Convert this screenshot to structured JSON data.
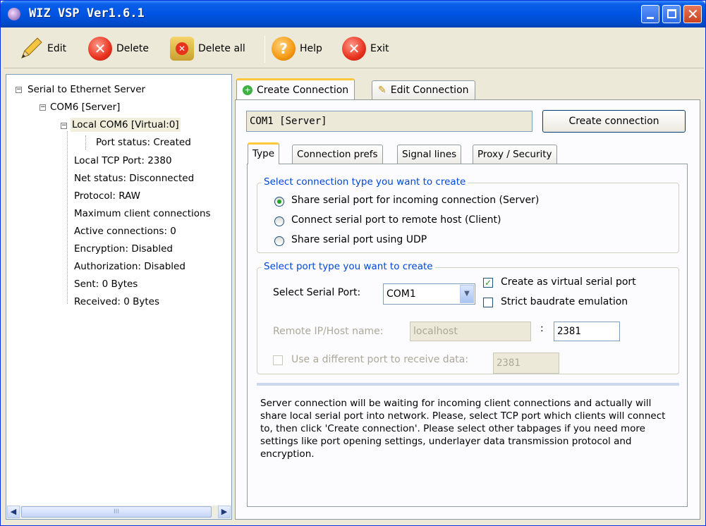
{
  "window": {
    "title": "WIZ VSP Ver1.6.1"
  },
  "toolbar": {
    "edit": "Edit",
    "delete": "Delete",
    "delete_all": "Delete all",
    "help": "Help",
    "exit": "Exit"
  },
  "tree": {
    "root": "Serial to Ethernet Server",
    "server": "COM6 [Server]",
    "local": "Local COM6 [Virtual:0]",
    "port_status": "Port status: Created",
    "items": [
      "Local TCP Port: 2380",
      "Net status: Disconnected",
      "Protocol: RAW",
      "Maximum client connections",
      "Active connections: 0",
      "Encryption: Disabled",
      "Authorization: Disabled",
      "Sent: 0 Bytes",
      "Received: 0 Bytes"
    ],
    "scroll_thumb": "III"
  },
  "tabs": {
    "create": "Create Connection",
    "edit": "Edit Connection"
  },
  "create": {
    "connection_name": "COM1 [Server]",
    "create_button": "Create connection",
    "inner_tabs": [
      "Type",
      "Connection prefs",
      "Signal lines",
      "Proxy / Security"
    ],
    "conn_type_legend": "Select connection type you want to create",
    "conn_types": [
      "Share serial port for incoming connection (Server)",
      "Connect serial port to remote host (Client)",
      "Share serial port using UDP"
    ],
    "port_type_legend": "Select port type you want to create",
    "serial_port_label": "Select Serial Port:",
    "serial_port_value": "COM1",
    "virtual_label": "Create as virtual serial port",
    "strict_label": "Strict baudrate emulation",
    "remote_label": "Remote IP/Host name:",
    "remote_host": "localhost",
    "colon": ":",
    "remote_port": "2381",
    "diff_port_label": "Use a different port to receive data:",
    "diff_port_value": "2381",
    "description": "Server connection will be waiting for incoming client connections and actually will share local serial port into network. Please, select TCP port which clients will connect to, then click 'Create connection'. Please select other tabpages if you need more settings like port opening settings, underlayer data transmission protocol and encryption."
  }
}
